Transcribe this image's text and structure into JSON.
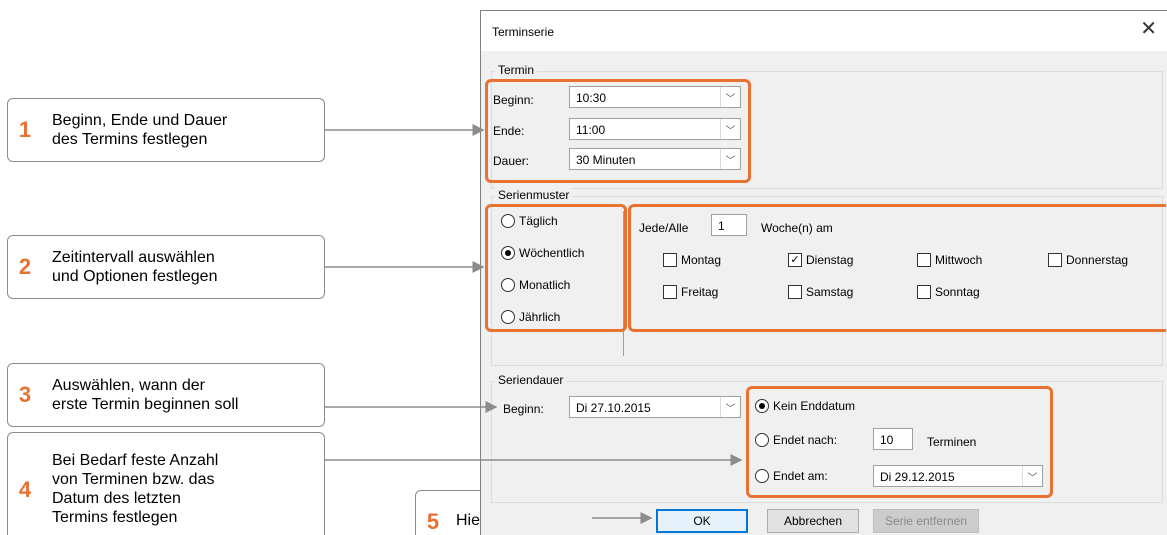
{
  "callouts": [
    {
      "num": "1",
      "text": "Beginn, Ende und Dauer\ndes Termins festlegen"
    },
    {
      "num": "2",
      "text": "Zeitintervall auswählen\nund Optionen festlegen"
    },
    {
      "num": "3",
      "text": "Auswählen, wann der\nerste Termin beginnen soll"
    },
    {
      "num": "4",
      "text": "Bei Bedarf feste Anzahl\nvon Terminen bzw. das\nDatum des letzten\nTermins festlegen"
    },
    {
      "num": "5",
      "text": "Hier klicken"
    }
  ],
  "dialog": {
    "title": "Terminserie",
    "close_glyph": "✕",
    "termin": {
      "group_label": "Termin",
      "begin_label": "Beginn:",
      "begin_value": "10:30",
      "end_label": "Ende:",
      "end_value": "11:00",
      "duration_label": "Dauer:",
      "duration_value": "30 Minuten"
    },
    "serienmuster": {
      "group_label": "Serienmuster",
      "options": [
        "Täglich",
        "Wöchentlich",
        "Monatlich",
        "Jährlich"
      ],
      "selected": "Wöchentlich",
      "every_label": "Jede/Alle",
      "every_value": "1",
      "weeks_label": "Woche(n) am",
      "days": [
        {
          "label": "Montag",
          "checked": false
        },
        {
          "label": "Dienstag",
          "checked": true
        },
        {
          "label": "Mittwoch",
          "checked": false
        },
        {
          "label": "Donnerstag",
          "checked": false
        },
        {
          "label": "Freitag",
          "checked": false
        },
        {
          "label": "Samstag",
          "checked": false
        },
        {
          "label": "Sonntag",
          "checked": false
        }
      ]
    },
    "seriendauer": {
      "group_label": "Seriendauer",
      "begin_label": "Beginn:",
      "begin_value": "Di 27.10.2015",
      "no_end_label": "Kein Enddatum",
      "ends_after_label": "Endet nach:",
      "ends_after_value": "10",
      "ends_after_unit": "Terminen",
      "ends_on_label": "Endet am:",
      "ends_on_value": "Di 29.12.2015",
      "selected": "Kein Enddatum"
    },
    "buttons": {
      "ok": "OK",
      "cancel": "Abbrechen",
      "remove": "Serie entfernen"
    }
  },
  "colors": {
    "accent": "#e97132",
    "default_button": "#0078d7"
  }
}
